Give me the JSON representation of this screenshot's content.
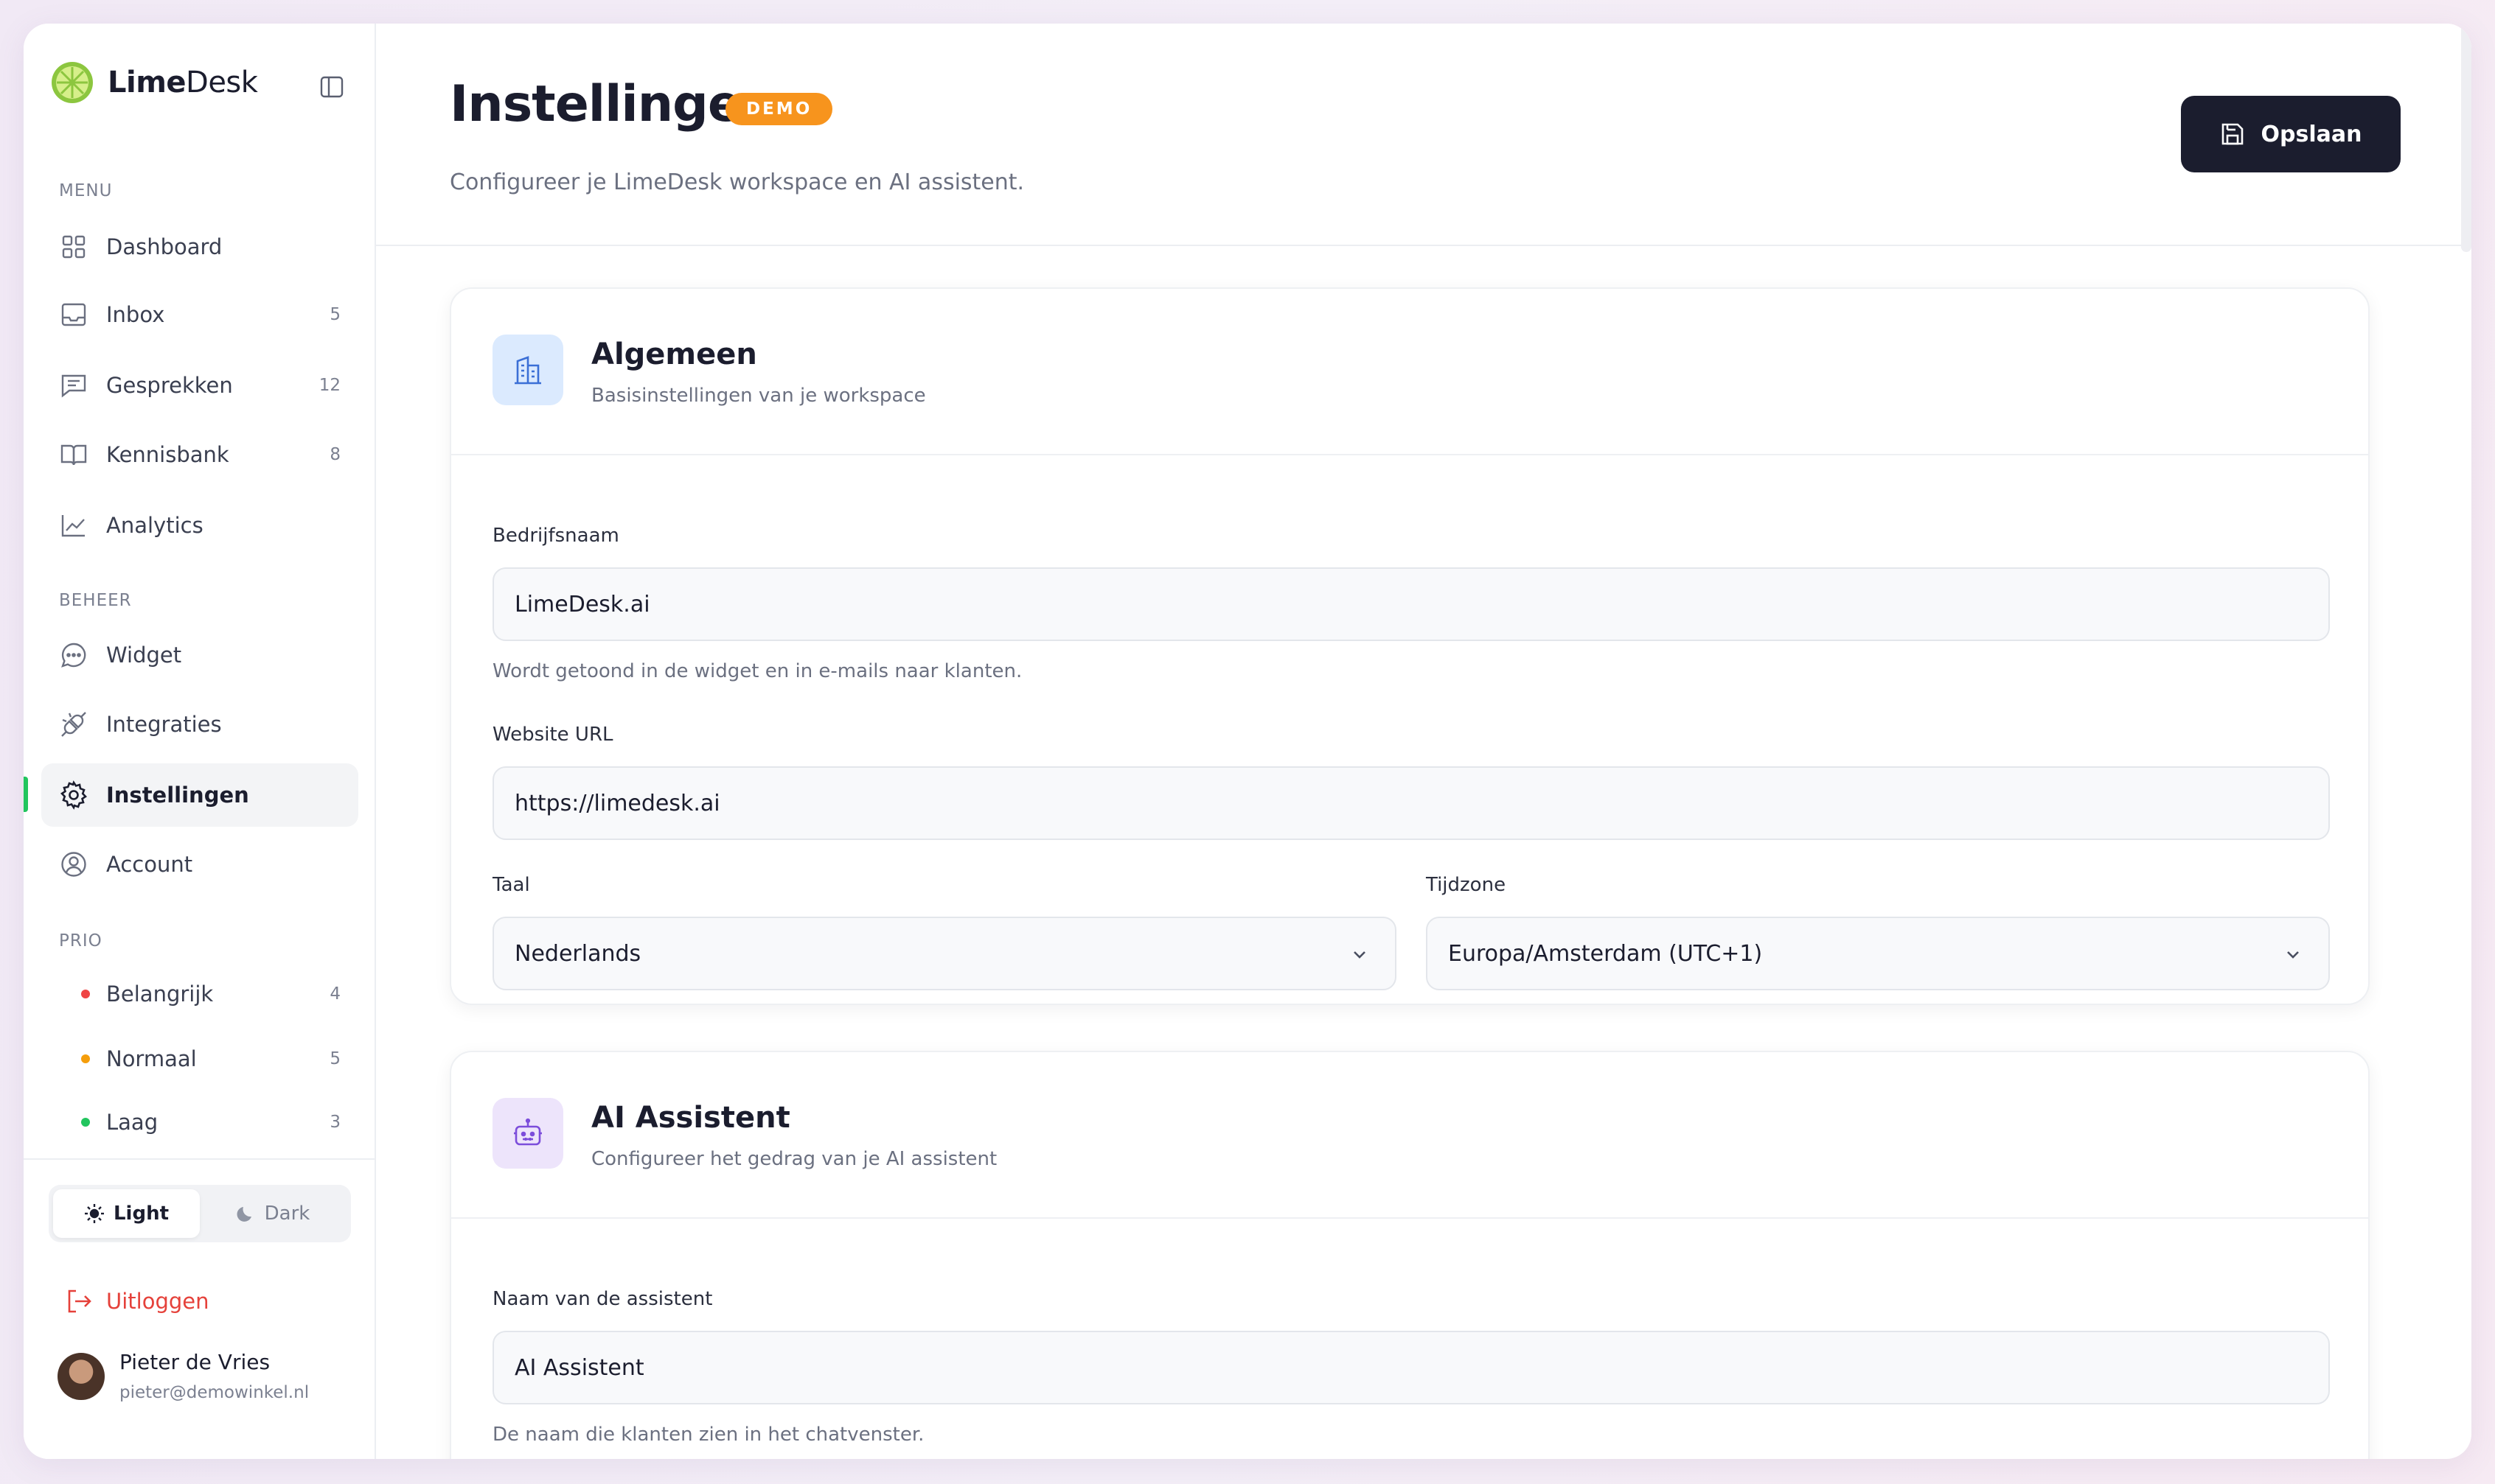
{
  "brand": {
    "name_bold": "Lime",
    "name_rest": "Desk"
  },
  "sidebar": {
    "sections": {
      "menu": "MENU",
      "beheer": "BEHEER",
      "prio": "PRIO"
    },
    "menu": [
      {
        "label": "Dashboard",
        "icon": "grid-icon",
        "count": ""
      },
      {
        "label": "Inbox",
        "icon": "inbox-icon",
        "count": "5"
      },
      {
        "label": "Gesprekken",
        "icon": "message-square-icon",
        "count": "12"
      },
      {
        "label": "Kennisbank",
        "icon": "book-icon",
        "count": "8"
      },
      {
        "label": "Analytics",
        "icon": "line-chart-icon",
        "count": ""
      }
    ],
    "beheer": [
      {
        "label": "Widget",
        "icon": "chat-bubble-icon"
      },
      {
        "label": "Integraties",
        "icon": "plug-icon"
      },
      {
        "label": "Instellingen",
        "icon": "gear-icon",
        "active": true
      },
      {
        "label": "Account",
        "icon": "user-circle-icon"
      }
    ],
    "prio": [
      {
        "label": "Belangrijk",
        "count": "4",
        "color": "#ef4444"
      },
      {
        "label": "Normaal",
        "count": "5",
        "color": "#f59e0b"
      },
      {
        "label": "Laag",
        "count": "3",
        "color": "#22c55e"
      }
    ],
    "theme": {
      "light": "Light",
      "dark": "Dark",
      "selected": "Light"
    },
    "logout": "Uitloggen",
    "user": {
      "name": "Pieter de Vries",
      "email": "pieter@demowinkel.nl"
    }
  },
  "header": {
    "title": "Instellingen",
    "badge": "DEMO",
    "subtitle": "Configureer je LimeDesk workspace en AI assistent.",
    "save_label": "Opslaan"
  },
  "general": {
    "title": "Algemeen",
    "subtitle": "Basisinstellingen van je workspace",
    "company_label": "Bedrijfsnaam",
    "company_value": "LimeDesk.ai",
    "company_hint": "Wordt getoond in de widget en in e-mails naar klanten.",
    "website_label": "Website URL",
    "website_value": "https://limedesk.ai",
    "language_label": "Taal",
    "language_value": "Nederlands",
    "timezone_label": "Tijdzone",
    "timezone_value": "Europa/Amsterdam (UTC+1)"
  },
  "assistant": {
    "title": "AI Assistent",
    "subtitle": "Configureer het gedrag van je AI assistent",
    "name_label": "Naam van de assistent",
    "name_value": "AI Assistent",
    "name_hint": "De naam die klanten zien in het chatvenster."
  },
  "colors": {
    "accent": "#22c55e",
    "badge": "#f7941d",
    "primary_button": "#1b1d2e",
    "danger": "#e5413a"
  }
}
